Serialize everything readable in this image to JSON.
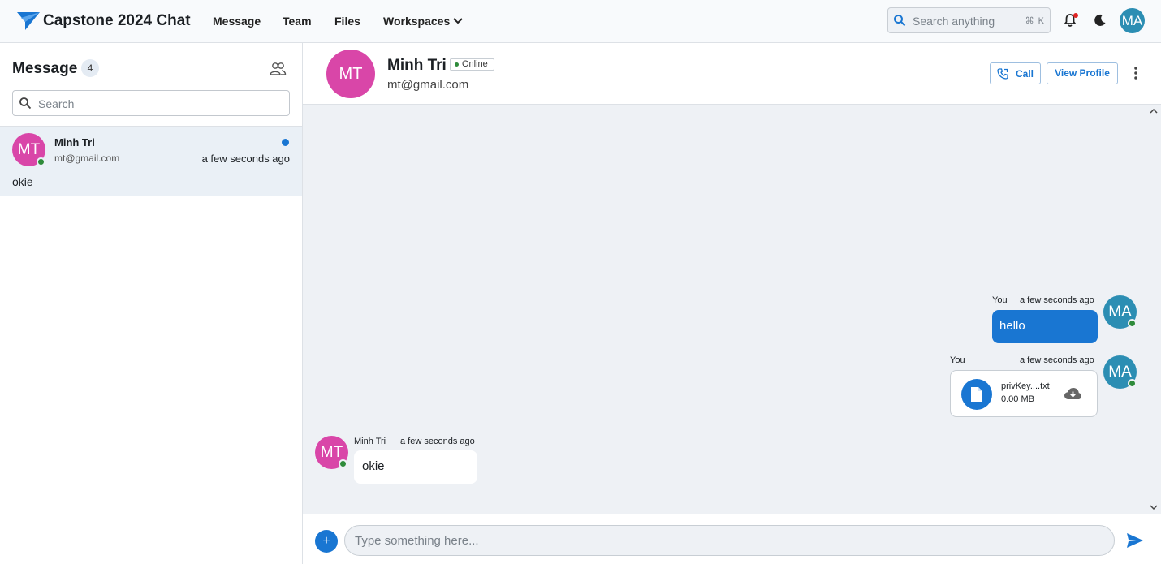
{
  "app": {
    "name": "Capstone 2024 Chat"
  },
  "nav": {
    "message": "Message",
    "team": "Team",
    "files": "Files",
    "workspaces": "Workspaces"
  },
  "topbar": {
    "search_placeholder": "Search anything",
    "search_shortcut": "⌘ K",
    "user_initials": "MA"
  },
  "sidebar": {
    "title": "Message",
    "count": "4",
    "search_placeholder": "Search",
    "conversations": [
      {
        "initials": "MT",
        "name": "Minh Tri",
        "email": "mt@gmail.com",
        "time": "a few seconds ago",
        "last_message": "okie"
      }
    ]
  },
  "chat_header": {
    "initials": "MT",
    "name": "Minh Tri",
    "status": "Online",
    "email": "mt@gmail.com",
    "call_label": "Call",
    "view_profile_label": "View Profile"
  },
  "messages": [
    {
      "sender": "You",
      "time": "a few seconds ago",
      "initials": "MA",
      "text": "hello"
    },
    {
      "sender": "You",
      "time": "a few seconds ago",
      "initials": "MA",
      "file_name": "privKey....txt",
      "file_size": "0.00 MB"
    },
    {
      "sender": "Minh Tri",
      "time": "a few seconds ago",
      "initials": "MT",
      "text": "okie"
    }
  ],
  "composer": {
    "add_label": "+",
    "placeholder": "Type something here..."
  },
  "colors": {
    "accent": "#1976d2",
    "avatar_mt": "#d946a8",
    "avatar_ma": "#2c8eb3",
    "online": "#2e8b3a",
    "chat_bg": "#eef1f5"
  }
}
